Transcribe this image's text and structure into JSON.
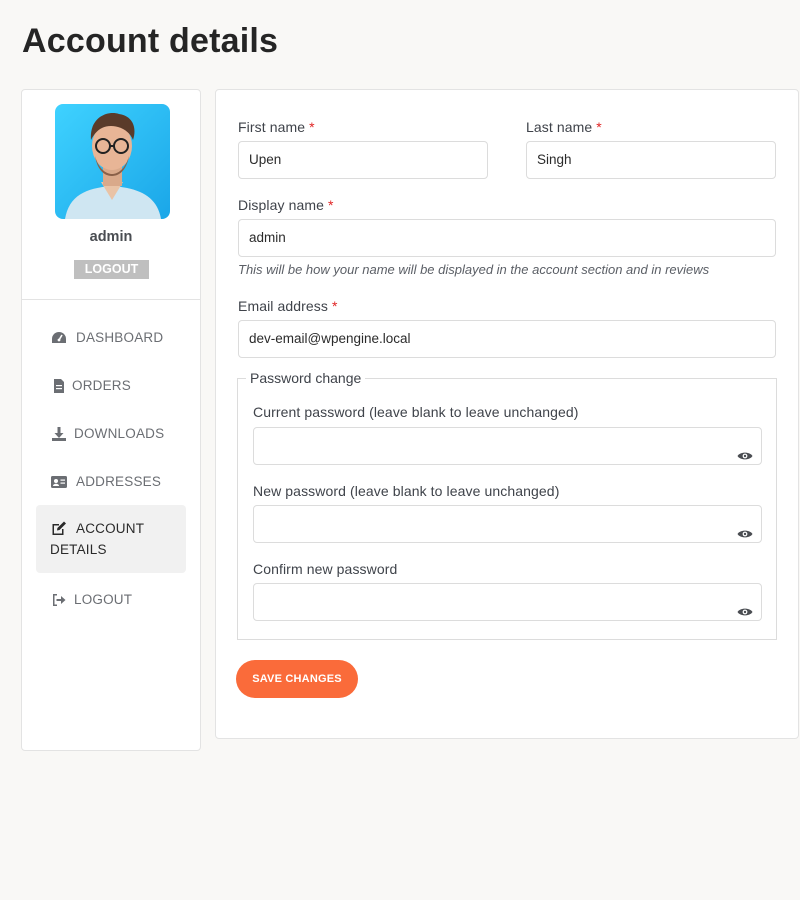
{
  "page_title": "Account details",
  "sidebar": {
    "username": "admin",
    "logout_badge": "LOGOUT",
    "items": [
      {
        "label": "DASHBOARD",
        "icon": "gauge-icon"
      },
      {
        "label": "ORDERS",
        "icon": "file-icon"
      },
      {
        "label": "DOWNLOADS",
        "icon": "download-icon"
      },
      {
        "label": "ADDRESSES",
        "icon": "address-card-icon"
      },
      {
        "label_line1": "ACCOUNT",
        "label_line2": "DETAILS",
        "icon": "edit-icon",
        "active": true
      },
      {
        "label": "LOGOUT",
        "icon": "sign-out-icon"
      }
    ]
  },
  "form": {
    "first_name": {
      "label": "First name",
      "required": "*",
      "value": "Upen"
    },
    "last_name": {
      "label": "Last name",
      "required": "*",
      "value": "Singh"
    },
    "display_name": {
      "label": "Display name",
      "required": "*",
      "value": "admin",
      "hint": "This will be how your name will be displayed in the account section and in reviews"
    },
    "email": {
      "label": "Email address",
      "required": "*",
      "value": "dev-email@wpengine.local"
    },
    "password_change": {
      "legend": "Password change",
      "current": {
        "label": "Current password (leave blank to leave unchanged)",
        "value": ""
      },
      "new": {
        "label": "New password (leave blank to leave unchanged)",
        "value": ""
      },
      "confirm": {
        "label": "Confirm new password",
        "value": ""
      }
    },
    "save_label": "SAVE CHANGES"
  },
  "colors": {
    "accent": "#fa6b3a",
    "required": "#e02424",
    "background": "#f9f8f6"
  }
}
